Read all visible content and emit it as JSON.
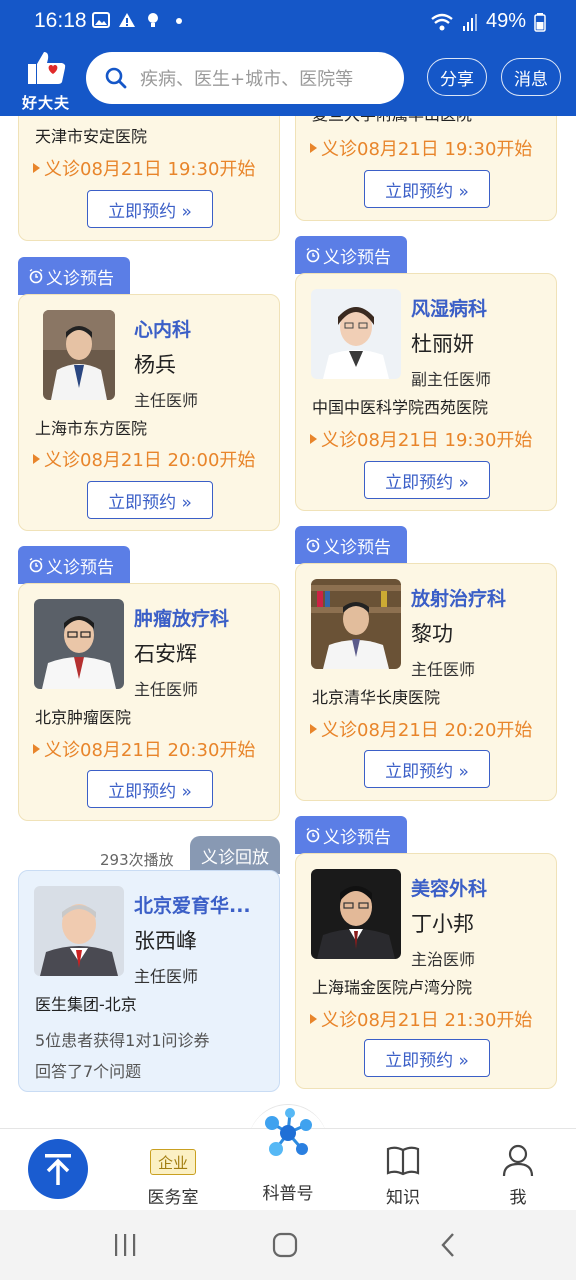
{
  "status_bar": {
    "time": "16:18",
    "battery": "49%"
  },
  "header": {
    "logo_text": "好大夫",
    "search_placeholder": "疾病、医生+城市、医院等",
    "share_label": "分享",
    "message_label": "消息"
  },
  "cards": {
    "top_left": {
      "hospital": "天津市安定医院",
      "time": "义诊08月21日 19:30开始",
      "button": "立即预约 »"
    },
    "top_right": {
      "hospital": "复旦大学附属华山医院",
      "time": "义诊08月21日 19:30开始",
      "button": "立即预约 »"
    },
    "c1": {
      "tag": "义诊预告",
      "dept": "心内科",
      "name": "杨兵",
      "title": "主任医师",
      "hospital": "上海市东方医院",
      "time": "义诊08月21日 20:00开始",
      "button": "立即预约 »"
    },
    "c2": {
      "tag": "义诊预告",
      "dept": "风湿病科",
      "name": "杜丽妍",
      "title": "副主任医师",
      "hospital": "中国中医科学院西苑医院",
      "time": "义诊08月21日 19:30开始",
      "button": "立即预约 »"
    },
    "c3": {
      "tag": "义诊预告",
      "dept": "肿瘤放疗科",
      "name": "石安辉",
      "title": "主任医师",
      "hospital": "北京肿瘤医院",
      "time": "义诊08月21日 20:30开始",
      "button": "立即预约 »"
    },
    "c4": {
      "tag": "义诊预告",
      "dept": "放射治疗科",
      "name": "黎功",
      "title": "主任医师",
      "hospital": "北京清华长庚医院",
      "time": "义诊08月21日 20:20开始",
      "button": "立即预约 »"
    },
    "c5": {
      "tag": "义诊回放",
      "plays": "293次播放",
      "dept": "北京爱育华...",
      "name": "张西峰",
      "title": "主任医师",
      "hospital": "医生集团-北京",
      "info1": "5位患者获得1对1问诊券",
      "info2": "回答了7个问题"
    },
    "c6": {
      "tag": "义诊预告",
      "dept": "美容外科",
      "name": "丁小邦",
      "title": "主治医师",
      "hospital": "上海瑞金医院卢湾分院",
      "time": "义诊08月21日 21:30开始",
      "button": "立即预约 »"
    }
  },
  "bottom_nav": {
    "items": [
      {
        "label": "医务室",
        "badge": "企业"
      },
      {
        "label": "科普号"
      },
      {
        "label": "知识"
      },
      {
        "label": "我"
      }
    ]
  },
  "colors": {
    "brand_blue": "#1557c8",
    "tag_blue": "#5b7ee6",
    "orange": "#e8852b",
    "card_bg": "#fdf7e4"
  }
}
